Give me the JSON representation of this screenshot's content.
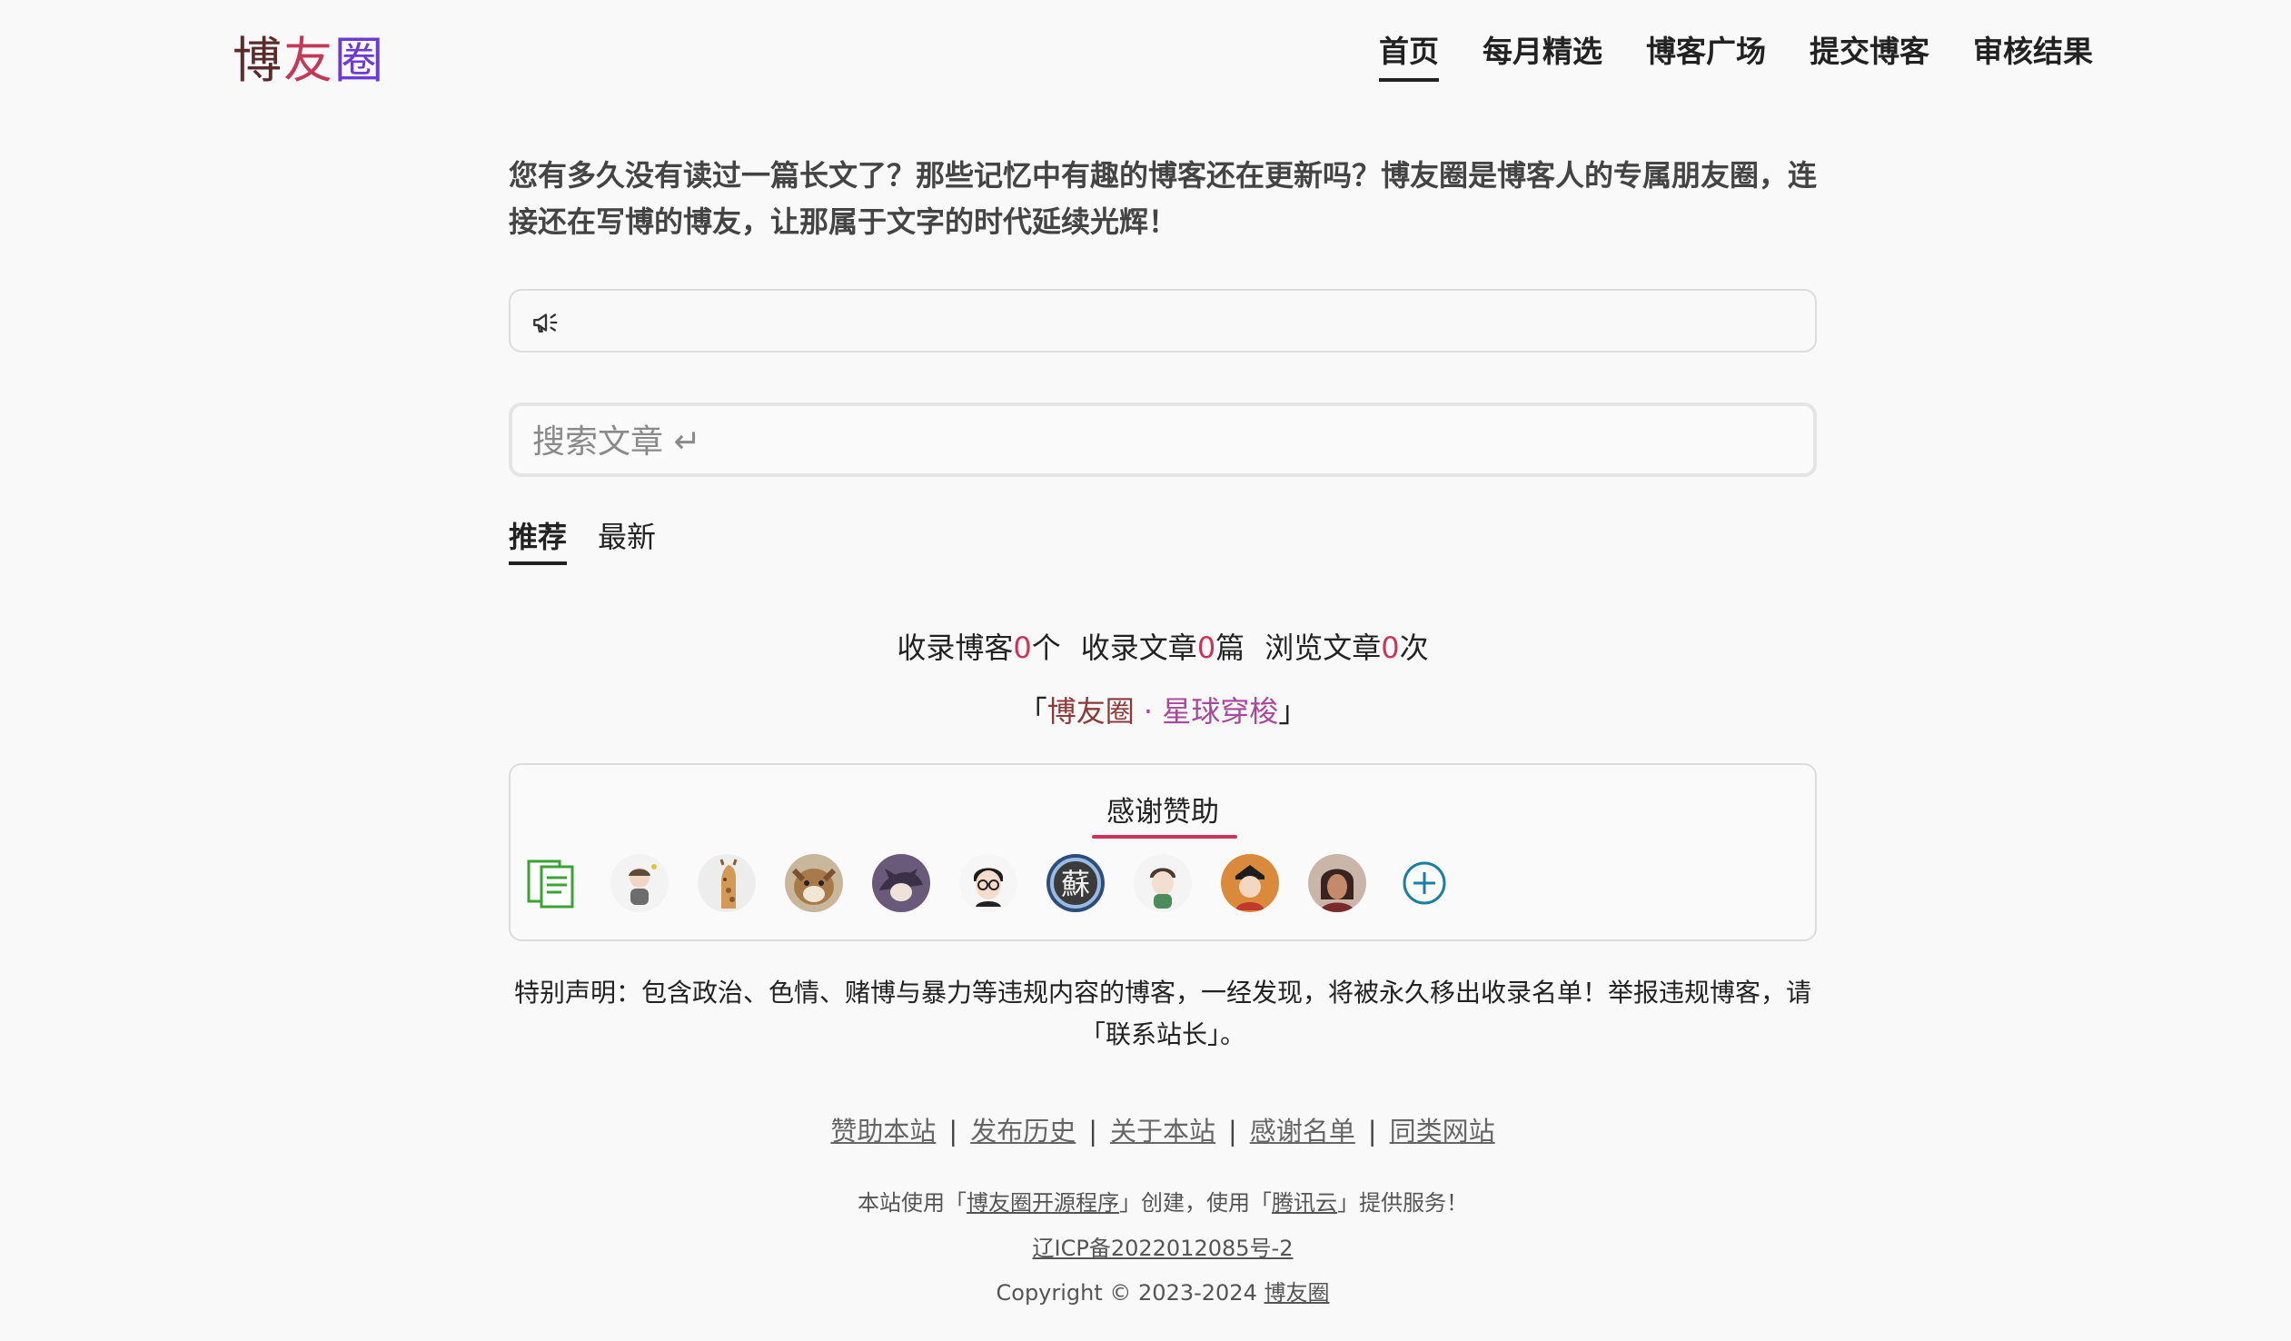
{
  "header": {
    "logo": [
      "博",
      "友",
      "圈"
    ],
    "nav": [
      "首页",
      "每月精选",
      "博客广场",
      "提交博客",
      "审核结果"
    ]
  },
  "intro": "您有多久没有读过一篇长文了？那些记忆中有趣的博客还在更新吗？博友圈是博客人的专属朋友圈，连接还在写博的博友，让那属于文字的时代延续光辉！",
  "search": {
    "placeholder": "搜索文章 ↵"
  },
  "tabs": [
    "推荐",
    "最新"
  ],
  "stats": {
    "blogs_label": "收录博客",
    "blogs_value": "0",
    "blogs_unit": "个",
    "articles_label": "收录文章",
    "articles_value": "0",
    "articles_unit": "篇",
    "views_label": "浏览文章",
    "views_value": "0",
    "views_unit": "次"
  },
  "tagline": {
    "open": "「",
    "part1": "博友圈",
    "sep": " · ",
    "part2": "星球穿梭",
    "close": "」"
  },
  "sponsor": {
    "title": "感谢赞助",
    "avatars": [
      "document-icon",
      "avatar",
      "avatar",
      "avatar",
      "avatar",
      "avatar",
      "avatar",
      "avatar",
      "avatar",
      "avatar",
      "add-icon"
    ]
  },
  "declaration": "特别声明：包含政治、色情、赌博与暴力等违规内容的博客，一经发现，将被永久移出收录名单！举报违规博客，请「联系站长」。",
  "footer": {
    "links": [
      "赞助本站",
      "发布历史",
      "关于本站",
      "感谢名单",
      "同类网站"
    ],
    "separator": "|",
    "powered_prefix": "本站使用「",
    "powered_program": "博友圈开源程序",
    "powered_mid": "」创建，使用「",
    "powered_host": "腾讯云",
    "powered_suffix": "」提供服务！",
    "icp": "辽ICP备2022012085号-2",
    "copyright_prefix": "Copyright © 2023-2024 ",
    "copyright_link": "博友圈"
  },
  "colors": {
    "accent": "#d0335a",
    "logo_1": "#5b2a2a",
    "logo_2": "#c23a58",
    "logo_3": "#6a3bd6"
  }
}
